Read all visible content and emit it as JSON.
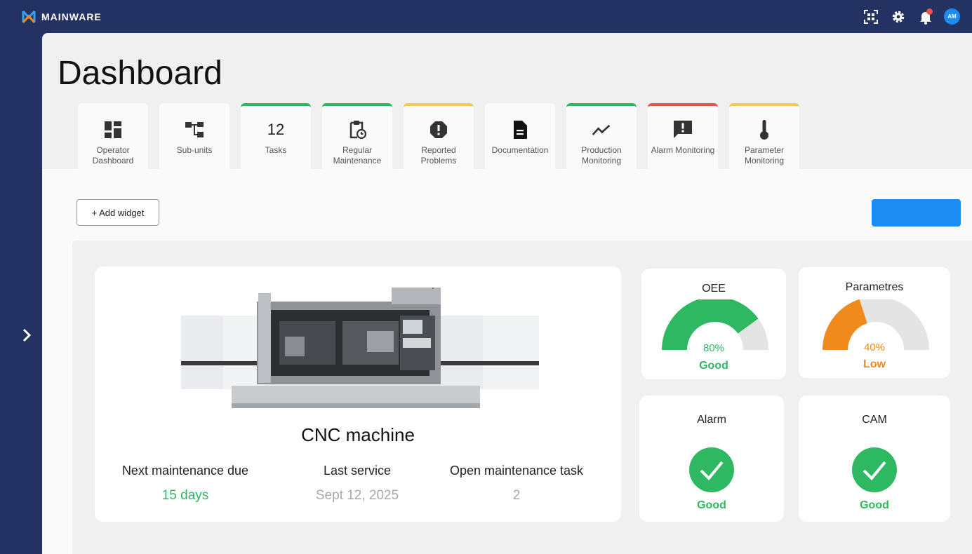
{
  "app": {
    "name": "MAINWARE"
  },
  "page": {
    "title": "Dashboard"
  },
  "topbar": {
    "icons": [
      "qr-scan-icon",
      "gear-icon",
      "bell-icon",
      "avatar"
    ],
    "avatar_initials": "AM"
  },
  "tabs": [
    {
      "label": "Operator Dashboard",
      "icon": "dashboard-grid-icon",
      "accent": ""
    },
    {
      "label": "Sub-units",
      "icon": "hierarchy-icon",
      "accent": ""
    },
    {
      "label": "Tasks",
      "count": "12",
      "accent": "#2eb862"
    },
    {
      "label": "Regular Maintenance",
      "icon": "clipboard-clock-icon",
      "accent": "#2eb862"
    },
    {
      "label": "Reported Problems",
      "icon": "alert-octagon-icon",
      "accent": "#f0cc54"
    },
    {
      "label": "Documentation",
      "icon": "document-icon",
      "accent": ""
    },
    {
      "label": "Production Monitoring",
      "icon": "trend-line-icon",
      "accent": "#2eb862"
    },
    {
      "label": "Alarm Monitoring",
      "icon": "alert-message-icon",
      "accent": "#e8554e"
    },
    {
      "label": "Parameter Monitoring",
      "icon": "thermometer-icon",
      "accent": "#f0cc54"
    }
  ],
  "toolbar": {
    "add_widget_label": "+ Add widget"
  },
  "machine": {
    "name": "CNC machine",
    "stats": [
      {
        "label": "Next maintenance due",
        "value": "15 days",
        "color": "#2eb862"
      },
      {
        "label": "Last service",
        "value": "Sept 12, 2025",
        "color": "#a8a8a8"
      },
      {
        "label": "Open maintenance task",
        "value": "2",
        "color": "#a8a8a8"
      }
    ]
  },
  "widgets": {
    "oee": {
      "title": "OEE",
      "percent": 80,
      "percent_label": "80%",
      "status": "Good",
      "color": "#2eb862"
    },
    "parametres": {
      "title": "Parametres",
      "percent": 40,
      "percent_label": "40%",
      "status": "Low",
      "color": "#f08a1c"
    },
    "alarm": {
      "title": "Alarm",
      "status": "Good",
      "icon": "check-circle-icon",
      "color": "#2eb862"
    },
    "cam": {
      "title": "CAM",
      "status": "Good",
      "icon": "check-circle-icon",
      "color": "#2eb862"
    }
  },
  "colors": {
    "navy": "#243163",
    "blue": "#1c8cf2",
    "gauge_track": "#e4e4e4"
  }
}
